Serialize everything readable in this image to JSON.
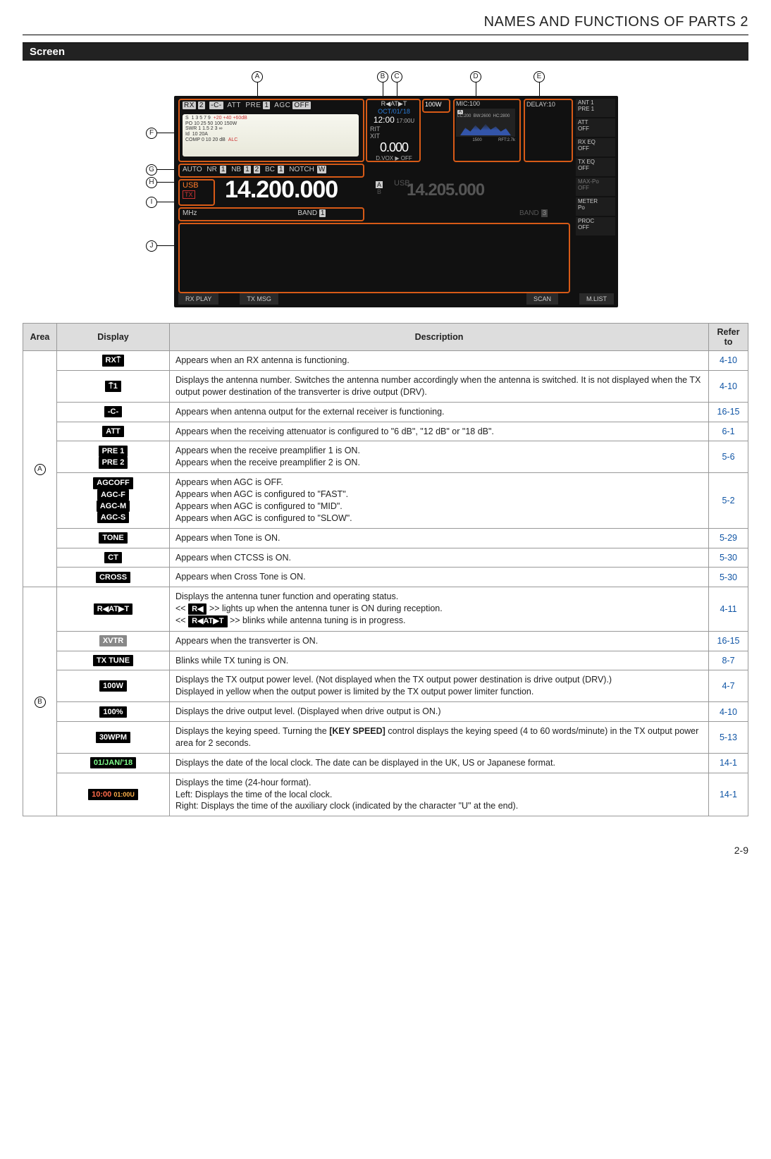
{
  "header": {
    "title": "NAMES AND FUNCTIONS OF PARTS  2"
  },
  "section": {
    "label": "Screen"
  },
  "callouts": {
    "A": "A",
    "B": "B",
    "C": "C",
    "D": "D",
    "E": "E",
    "F": "F",
    "G": "G",
    "H": "H",
    "I": "I",
    "J": "J"
  },
  "screen": {
    "rowA": {
      "rx": "RX",
      "ant_no": "2",
      "ext": "-C-",
      "att": "ATT",
      "pre": "PRE",
      "pre_no": "1",
      "agc": "AGC",
      "agc_val": "OFF"
    },
    "meter": {
      "s_ticks": "1  3  5  7  9",
      "s_plus": "+20   +40   +60dB",
      "po_lab": "PO",
      "po_ticks": "10  25  50           100  150W",
      "swr_lab": "SWR",
      "swr_ticks": "1 1.5  2  3        ∞",
      "id_lab": "Id",
      "id_ticks": "         10          20A",
      "comp_lab": "COMP",
      "comp_ticks": "0  10  20      dB",
      "alc": "ALC"
    },
    "blockB": {
      "rat": "R◀AT▶T",
      "date": "OCT/01/'18",
      "time": "12:00",
      "time_aux": "17:00U",
      "rit": "RIT",
      "xit": "XIT",
      "zero": "0.000",
      "dvox": "D.VOX ▶ OFF"
    },
    "blockC": {
      "pwr": "100W"
    },
    "blockD": {
      "mic": "MIC:100",
      "a": "A",
      "lc": "LC:200",
      "bw": "BW:2600",
      "hc": "HC:2800",
      "cf": "1500",
      "rft": "RFT:2.7k"
    },
    "blockE": {
      "delay": "DELAY:10"
    },
    "rowG": {
      "auto": "AUTO",
      "nr": "NR",
      "nr_no": "1",
      "nb": "NB",
      "nb_no": "1",
      "nb_no2": "2",
      "bc": "BC",
      "bc_no": "1",
      "notch": "NOTCH",
      "w": "W"
    },
    "blockH": {
      "usb": "USB",
      "tx": "TX"
    },
    "freq_main": "14.200.000",
    "ab": {
      "a": "A",
      "b": "B"
    },
    "usb_sub": "USB",
    "freq_sub": "14.205.000",
    "rowI": {
      "mhz": "MHz",
      "band": "BAND",
      "band_no": "1",
      "band3": "BAND",
      "band3_no": "3"
    },
    "side": [
      {
        "l1": "ANT 1",
        "l2": "PRE 1"
      },
      {
        "l1": "ATT",
        "l2": "OFF"
      },
      {
        "l1": "RX EQ",
        "l2": "OFF"
      },
      {
        "l1": "TX EQ",
        "l2": "OFF"
      },
      {
        "l1": "MAX-Po",
        "l2": "OFF"
      },
      {
        "l1": "METER",
        "l2": "Po"
      },
      {
        "l1": "PROC",
        "l2": "OFF"
      }
    ],
    "bottom": [
      "RX PLAY",
      "TX MSG",
      "SCAN",
      "M.LIST"
    ]
  },
  "table": {
    "headers": {
      "area": "Area",
      "display": "Display",
      "description": "Description",
      "refer": "Refer to"
    },
    "groupA": {
      "area": "A",
      "rows": [
        {
          "badges": [
            "RX⍑"
          ],
          "desc": "Appears when an RX antenna is functioning.",
          "ref": "4-10"
        },
        {
          "badges": [
            "⍑1"
          ],
          "desc": "Displays the antenna number. Switches the antenna number accordingly when the antenna is switched. It is not displayed when the TX output power destination of the transverter is drive output (DRV).",
          "ref": "4-10"
        },
        {
          "badges": [
            "-C-"
          ],
          "desc": "Appears when antenna output for the external receiver is functioning.",
          "ref": "16-15"
        },
        {
          "badges": [
            "ATT"
          ],
          "desc": "Appears when the receiving attenuator is configured to \"6 dB\", \"12 dB\" or \"18 dB\".",
          "ref": "6-1"
        },
        {
          "badges": [
            "PRE 1",
            "PRE 2"
          ],
          "desc_lines": [
            "Appears when the receive preamplifier 1 is ON.",
            "Appears when the receive preamplifier 2 is ON."
          ],
          "ref": "5-6"
        },
        {
          "badges": [
            "AGCOFF",
            "AGC-F",
            "AGC-M",
            "AGC-S"
          ],
          "desc_lines": [
            "Appears when AGC is OFF.",
            "Appears when AGC is configured to \"FAST\".",
            "Appears when AGC is configured to \"MID\".",
            "Appears when AGC is configured to \"SLOW\"."
          ],
          "ref": "5-2"
        },
        {
          "badges": [
            "TONE"
          ],
          "desc": "Appears when Tone is ON.",
          "ref": "5-29"
        },
        {
          "badges": [
            "CT"
          ],
          "desc": "Appears when CTCSS is ON.",
          "ref": "5-30"
        },
        {
          "badges": [
            "CROSS"
          ],
          "desc": "Appears when Cross Tone is ON.",
          "ref": "5-30"
        }
      ]
    },
    "groupB": {
      "area": "B",
      "rows": [
        {
          "badges": [
            "R◀AT▶T"
          ],
          "desc_html": "Displays the antenna tuner function and operating status.<br><< <span class='badge'>R◀</span> >> lights up when the antenna tuner is ON during reception.<br><< <span class='badge'>R◀AT▶T</span> >> blinks while antenna tuning is in progress.",
          "ref": "4-11"
        },
        {
          "badges_gray": [
            "XVTR"
          ],
          "desc": "Appears when the transverter is ON.",
          "ref": "16-15"
        },
        {
          "badges": [
            "TX TUNE"
          ],
          "desc": "Blinks while TX tuning is ON.",
          "ref": "8-7"
        },
        {
          "badges": [
            "100W"
          ],
          "desc_lines": [
            "Displays the TX output power level. (Not displayed when the TX output power destination is drive output (DRV).)",
            "Displayed in yellow when the output power is limited by the TX output power limiter function."
          ],
          "ref": "4-7"
        },
        {
          "badges": [
            "100%"
          ],
          "desc": "Displays the drive output level. (Displayed when drive output is ON.)",
          "ref": "4-10"
        },
        {
          "badges": [
            "30WPM"
          ],
          "desc_html": "Displays the keying speed. Turning the <b>[KEY SPEED]</b> control displays the keying speed (4 to 60 words/minute) in the TX output power area for 2 seconds.",
          "ref": "5-13"
        },
        {
          "badges_grn": [
            "01/JAN/'18"
          ],
          "desc": "Displays the date of the local clock. The date can be displayed in the UK, US or Japanese format.",
          "ref": "14-1"
        },
        {
          "badge_time": {
            "main": "10:00",
            "aux": "01:00U"
          },
          "desc_lines": [
            "Displays the time (24-hour format).",
            "Left: Displays the time of the local clock.",
            "Right: Displays the time of the auxiliary clock (indicated by the character \"U\" at the end)."
          ],
          "ref": "14-1"
        }
      ]
    }
  },
  "footer": {
    "page": "2-9"
  }
}
